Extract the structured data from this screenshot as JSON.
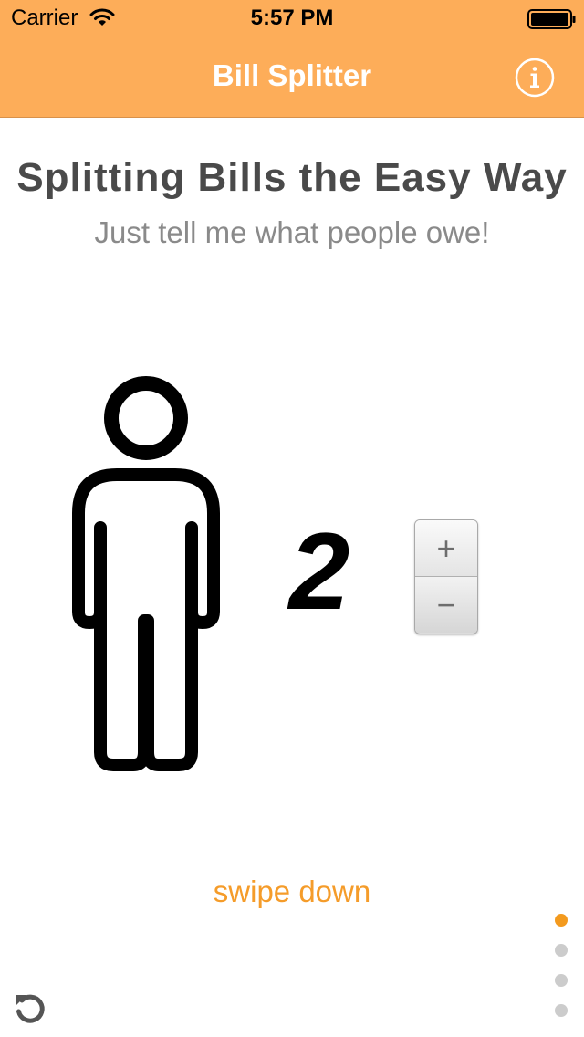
{
  "status_bar": {
    "carrier": "Carrier",
    "time": "5:57 PM",
    "wifi_icon": "wifi-icon",
    "battery_icon": "battery-icon"
  },
  "nav": {
    "title": "Bill Splitter",
    "info_icon": "info-icon"
  },
  "main": {
    "headline": "Splitting Bills the Easy Way",
    "subhead": "Just tell me what people owe!",
    "person_icon": "person-icon",
    "people_count": "2",
    "stepper": {
      "plus_label": "+",
      "minus_label": "−"
    },
    "swipe_hint": "swipe down"
  },
  "pager": {
    "pages": 4,
    "active_page": 1
  },
  "footer": {
    "reset_icon": "refresh-icon"
  },
  "colors": {
    "nav_background": "#fdad59",
    "accent": "#f59c2a",
    "dot_active": "#f39a1e",
    "dot_inactive": "#cccccc",
    "headline": "#4a4a4a",
    "subhead": "#8a8a8a"
  }
}
